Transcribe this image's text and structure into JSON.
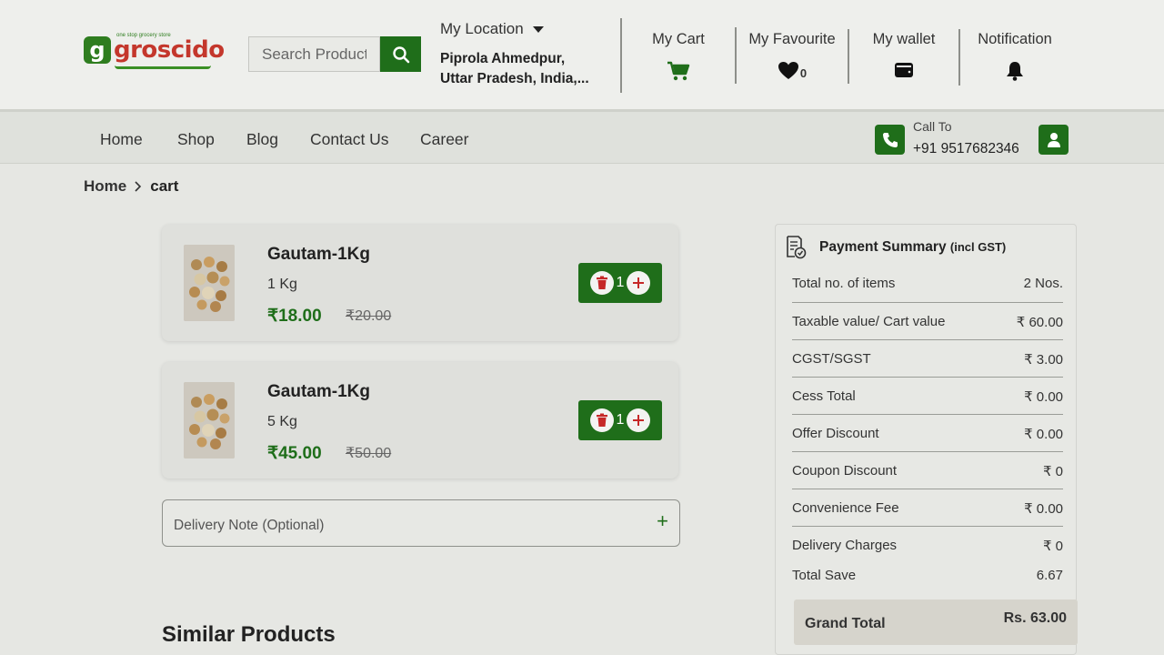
{
  "header": {
    "logo": {
      "mark": "g",
      "word": "groscido",
      "tagline": "one stop grocery store"
    },
    "search": {
      "placeholder": "Search Product",
      "button_icon": "search-icon"
    },
    "location": {
      "label": "My Location",
      "line1": "Piprola Ahmedpur,",
      "line2": "Uttar Pradesh, India,..."
    },
    "nav": [
      {
        "label": "My Cart",
        "icon": "cart-icon"
      },
      {
        "label": "My Favourite",
        "icon": "heart-icon",
        "count": "0"
      },
      {
        "label": "My wallet",
        "icon": "wallet-icon"
      },
      {
        "label": "Notification",
        "icon": "bell-icon"
      }
    ]
  },
  "navbar": {
    "links": [
      "Home",
      "Shop",
      "Blog",
      "Contact Us",
      "Career"
    ],
    "call": {
      "label": "Call To",
      "number": "+91 9517682346",
      "icon": "phone-icon"
    },
    "user_icon": "user-icon"
  },
  "breadcrumb": {
    "home": "Home",
    "separator": ">",
    "current": "cart"
  },
  "cart": {
    "items": [
      {
        "name": "Gautam-1Kg",
        "unit": "1 Kg",
        "price": "₹18.00",
        "mrp": "₹20.00",
        "qty": "1"
      },
      {
        "name": "Gautam-1Kg",
        "unit": "5 Kg",
        "price": "₹45.00",
        "mrp": "₹50.00",
        "qty": "1"
      }
    ],
    "delivery_note": {
      "placeholder": "Delivery Note (Optional)",
      "plus": "+"
    }
  },
  "similar_title": "Similar Products",
  "summary": {
    "title": "Payment Summary",
    "title_suffix": "(incl GST)",
    "rows": [
      {
        "label": "Total no. of items",
        "value": "2 Nos."
      },
      {
        "label": "Taxable value/ Cart value",
        "value": "₹ 60.00"
      },
      {
        "label": "CGST/SGST",
        "value": "₹ 3.00"
      },
      {
        "label": "Cess Total",
        "value": "₹ 0.00"
      },
      {
        "label": "Offer Discount",
        "value": "₹ 0.00"
      },
      {
        "label": "Coupon Discount",
        "value": "₹ 0"
      },
      {
        "label": "Convenience Fee",
        "value": "₹ 0.00"
      },
      {
        "label": "Delivery Charges",
        "value": "₹ 0"
      },
      {
        "label": "Total Save",
        "value": "6.67"
      }
    ],
    "grand_total": {
      "label": "Grand Total",
      "value": "Rs. 63.00"
    }
  },
  "colors": {
    "brand_green": "#1f6e1a",
    "brand_red": "#c4372c",
    "delete_red": "#c62828"
  }
}
